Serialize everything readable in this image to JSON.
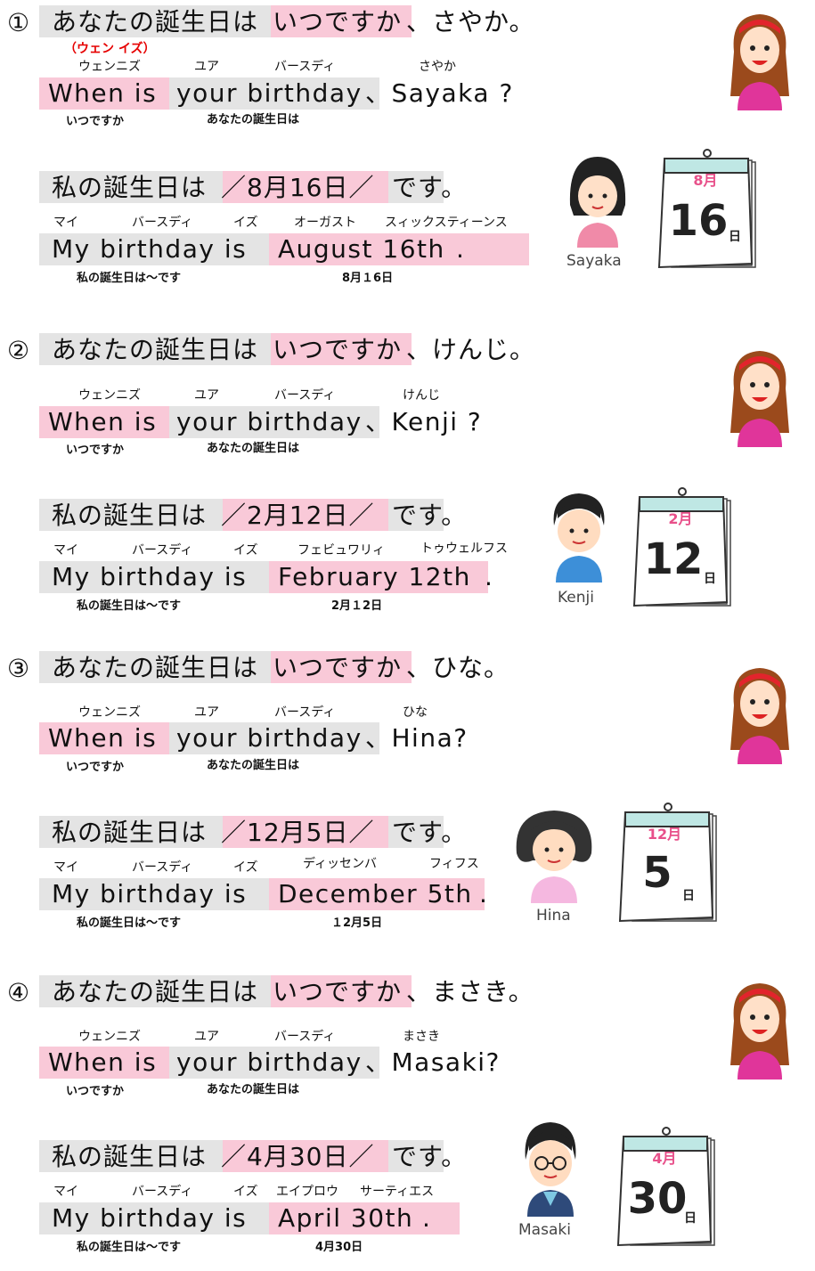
{
  "colors": {
    "highlight_pink": "#f9c9d8",
    "highlight_gray": "#e4e4e4",
    "ruby_red": "#e60000",
    "calendar_month": "#e8508a",
    "calendar_top": "#bfe7e4"
  },
  "sections": [
    {
      "number": "①",
      "question_jp": {
        "part1": "あなたの誕生日は",
        "part2": "いつですか",
        "part3": "、さやか。"
      },
      "special_ruby": "（ウェン イズ）",
      "ruby": {
        "when_is": "ウェンニズ",
        "your": "ユア",
        "birthday": "バースディ",
        "name": "さやか"
      },
      "question_en": {
        "when_is": "When is",
        "your_birthday": "your birthday",
        "rest": "、Sayaka ?"
      },
      "gloss_q": {
        "when_is": "いつですか",
        "your_birthday": "あなたの誕生日は"
      },
      "answer_jp": {
        "part1": "私の誕生日は",
        "part2": "／8月16日／",
        "part3": "です。"
      },
      "ruby_a": {
        "my": "マイ",
        "birthday": "バースディ",
        "is": "イズ",
        "month": "オーガスト",
        "day": "スィックスティーンス"
      },
      "answer_en": {
        "my_birthday_is": "My birthday is",
        "date": "August 16th",
        "period": "."
      },
      "gloss_a": {
        "left": "私の誕生日は～です",
        "date": "8月１6日"
      },
      "person": "Sayaka",
      "calendar": {
        "month": "8月",
        "day": "16",
        "day_label": "日"
      }
    },
    {
      "number": "②",
      "question_jp": {
        "part1": "あなたの誕生日は",
        "part2": "いつですか",
        "part3": "、けんじ。"
      },
      "ruby": {
        "when_is": "ウェンニズ",
        "your": "ユア",
        "birthday": "バースディ",
        "name": "けんじ"
      },
      "question_en": {
        "when_is": "When is",
        "your_birthday": "your birthday",
        "rest": "、Kenji ?"
      },
      "gloss_q": {
        "when_is": "いつですか",
        "your_birthday": "あなたの誕生日は"
      },
      "answer_jp": {
        "part1": "私の誕生日は",
        "part2": "／2月12日／",
        "part3": "です。"
      },
      "ruby_a": {
        "my": "マイ",
        "birthday": "バースディ",
        "is": "イズ",
        "month": "フェビュワリィ",
        "day": "トゥウェルフス"
      },
      "answer_en": {
        "my_birthday_is": "My birthday is",
        "date": "February 12th",
        "period": "."
      },
      "gloss_a": {
        "left": "私の誕生日は～です",
        "date": "2月１2日"
      },
      "person": "Kenji",
      "calendar": {
        "month": "2月",
        "day": "12",
        "day_label": "日"
      }
    },
    {
      "number": "③",
      "question_jp": {
        "part1": "あなたの誕生日は",
        "part2": "いつですか",
        "part3": "、ひな。"
      },
      "ruby": {
        "when_is": "ウェンニズ",
        "your": "ユア",
        "birthday": "バースディ",
        "name": "ひな"
      },
      "question_en": {
        "when_is": "When is",
        "your_birthday": "your birthday",
        "rest": "、Hina?"
      },
      "gloss_q": {
        "when_is": "いつですか",
        "your_birthday": "あなたの誕生日は"
      },
      "answer_jp": {
        "part1": "私の誕生日は",
        "part2": "／12月5日／",
        "part3": "です。"
      },
      "ruby_a": {
        "my": "マイ",
        "birthday": "バースディ",
        "is": "イズ",
        "month": "ディッセンバ",
        "day": "フィフス"
      },
      "answer_en": {
        "my_birthday_is": "My birthday is",
        "date": "December 5th",
        "period": "."
      },
      "gloss_a": {
        "left": "私の誕生日は～です",
        "date": "１2月5日"
      },
      "person": "Hina",
      "calendar": {
        "month": "12月",
        "day": "5",
        "day_label": "日"
      }
    },
    {
      "number": "④",
      "question_jp": {
        "part1": "あなたの誕生日は",
        "part2": "いつですか",
        "part3": "、まさき。"
      },
      "ruby": {
        "when_is": "ウェンニズ",
        "your": "ユア",
        "birthday": "バースディ",
        "name": "まさき"
      },
      "question_en": {
        "when_is": "When is",
        "your_birthday": "your birthday",
        "rest": "、Masaki?"
      },
      "gloss_q": {
        "when_is": "いつですか",
        "your_birthday": "あなたの誕生日は"
      },
      "answer_jp": {
        "part1": "私の誕生日は",
        "part2": "／4月30日／",
        "part3": "です。"
      },
      "ruby_a": {
        "my": "マイ",
        "birthday": "バースディ",
        "is": "イズ",
        "month": "エイプロウ",
        "day": "サーティエス"
      },
      "answer_en": {
        "my_birthday_is": "My birthday is",
        "date": "April 30th",
        "period": "."
      },
      "gloss_a": {
        "left": "私の誕生日は～です",
        "date": "4月30日"
      },
      "person": "Masaki",
      "calendar": {
        "month": "4月",
        "day": "30",
        "day_label": "日"
      }
    }
  ]
}
